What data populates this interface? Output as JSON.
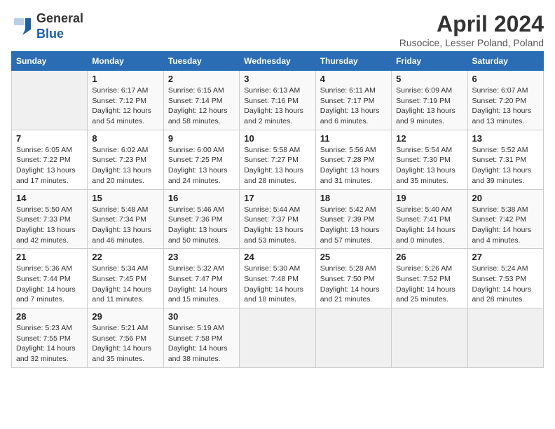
{
  "header": {
    "logo_line1": "General",
    "logo_line2": "Blue",
    "month_title": "April 2024",
    "location": "Rusocice, Lesser Poland, Poland"
  },
  "weekdays": [
    "Sunday",
    "Monday",
    "Tuesday",
    "Wednesday",
    "Thursday",
    "Friday",
    "Saturday"
  ],
  "weeks": [
    [
      {
        "day": "",
        "info": ""
      },
      {
        "day": "1",
        "info": "Sunrise: 6:17 AM\nSunset: 7:12 PM\nDaylight: 12 hours\nand 54 minutes."
      },
      {
        "day": "2",
        "info": "Sunrise: 6:15 AM\nSunset: 7:14 PM\nDaylight: 12 hours\nand 58 minutes."
      },
      {
        "day": "3",
        "info": "Sunrise: 6:13 AM\nSunset: 7:16 PM\nDaylight: 13 hours\nand 2 minutes."
      },
      {
        "day": "4",
        "info": "Sunrise: 6:11 AM\nSunset: 7:17 PM\nDaylight: 13 hours\nand 6 minutes."
      },
      {
        "day": "5",
        "info": "Sunrise: 6:09 AM\nSunset: 7:19 PM\nDaylight: 13 hours\nand 9 minutes."
      },
      {
        "day": "6",
        "info": "Sunrise: 6:07 AM\nSunset: 7:20 PM\nDaylight: 13 hours\nand 13 minutes."
      }
    ],
    [
      {
        "day": "7",
        "info": "Sunrise: 6:05 AM\nSunset: 7:22 PM\nDaylight: 13 hours\nand 17 minutes."
      },
      {
        "day": "8",
        "info": "Sunrise: 6:02 AM\nSunset: 7:23 PM\nDaylight: 13 hours\nand 20 minutes."
      },
      {
        "day": "9",
        "info": "Sunrise: 6:00 AM\nSunset: 7:25 PM\nDaylight: 13 hours\nand 24 minutes."
      },
      {
        "day": "10",
        "info": "Sunrise: 5:58 AM\nSunset: 7:27 PM\nDaylight: 13 hours\nand 28 minutes."
      },
      {
        "day": "11",
        "info": "Sunrise: 5:56 AM\nSunset: 7:28 PM\nDaylight: 13 hours\nand 31 minutes."
      },
      {
        "day": "12",
        "info": "Sunrise: 5:54 AM\nSunset: 7:30 PM\nDaylight: 13 hours\nand 35 minutes."
      },
      {
        "day": "13",
        "info": "Sunrise: 5:52 AM\nSunset: 7:31 PM\nDaylight: 13 hours\nand 39 minutes."
      }
    ],
    [
      {
        "day": "14",
        "info": "Sunrise: 5:50 AM\nSunset: 7:33 PM\nDaylight: 13 hours\nand 42 minutes."
      },
      {
        "day": "15",
        "info": "Sunrise: 5:48 AM\nSunset: 7:34 PM\nDaylight: 13 hours\nand 46 minutes."
      },
      {
        "day": "16",
        "info": "Sunrise: 5:46 AM\nSunset: 7:36 PM\nDaylight: 13 hours\nand 50 minutes."
      },
      {
        "day": "17",
        "info": "Sunrise: 5:44 AM\nSunset: 7:37 PM\nDaylight: 13 hours\nand 53 minutes."
      },
      {
        "day": "18",
        "info": "Sunrise: 5:42 AM\nSunset: 7:39 PM\nDaylight: 13 hours\nand 57 minutes."
      },
      {
        "day": "19",
        "info": "Sunrise: 5:40 AM\nSunset: 7:41 PM\nDaylight: 14 hours\nand 0 minutes."
      },
      {
        "day": "20",
        "info": "Sunrise: 5:38 AM\nSunset: 7:42 PM\nDaylight: 14 hours\nand 4 minutes."
      }
    ],
    [
      {
        "day": "21",
        "info": "Sunrise: 5:36 AM\nSunset: 7:44 PM\nDaylight: 14 hours\nand 7 minutes."
      },
      {
        "day": "22",
        "info": "Sunrise: 5:34 AM\nSunset: 7:45 PM\nDaylight: 14 hours\nand 11 minutes."
      },
      {
        "day": "23",
        "info": "Sunrise: 5:32 AM\nSunset: 7:47 PM\nDaylight: 14 hours\nand 15 minutes."
      },
      {
        "day": "24",
        "info": "Sunrise: 5:30 AM\nSunset: 7:48 PM\nDaylight: 14 hours\nand 18 minutes."
      },
      {
        "day": "25",
        "info": "Sunrise: 5:28 AM\nSunset: 7:50 PM\nDaylight: 14 hours\nand 21 minutes."
      },
      {
        "day": "26",
        "info": "Sunrise: 5:26 AM\nSunset: 7:52 PM\nDaylight: 14 hours\nand 25 minutes."
      },
      {
        "day": "27",
        "info": "Sunrise: 5:24 AM\nSunset: 7:53 PM\nDaylight: 14 hours\nand 28 minutes."
      }
    ],
    [
      {
        "day": "28",
        "info": "Sunrise: 5:23 AM\nSunset: 7:55 PM\nDaylight: 14 hours\nand 32 minutes."
      },
      {
        "day": "29",
        "info": "Sunrise: 5:21 AM\nSunset: 7:56 PM\nDaylight: 14 hours\nand 35 minutes."
      },
      {
        "day": "30",
        "info": "Sunrise: 5:19 AM\nSunset: 7:58 PM\nDaylight: 14 hours\nand 38 minutes."
      },
      {
        "day": "",
        "info": ""
      },
      {
        "day": "",
        "info": ""
      },
      {
        "day": "",
        "info": ""
      },
      {
        "day": "",
        "info": ""
      }
    ]
  ]
}
